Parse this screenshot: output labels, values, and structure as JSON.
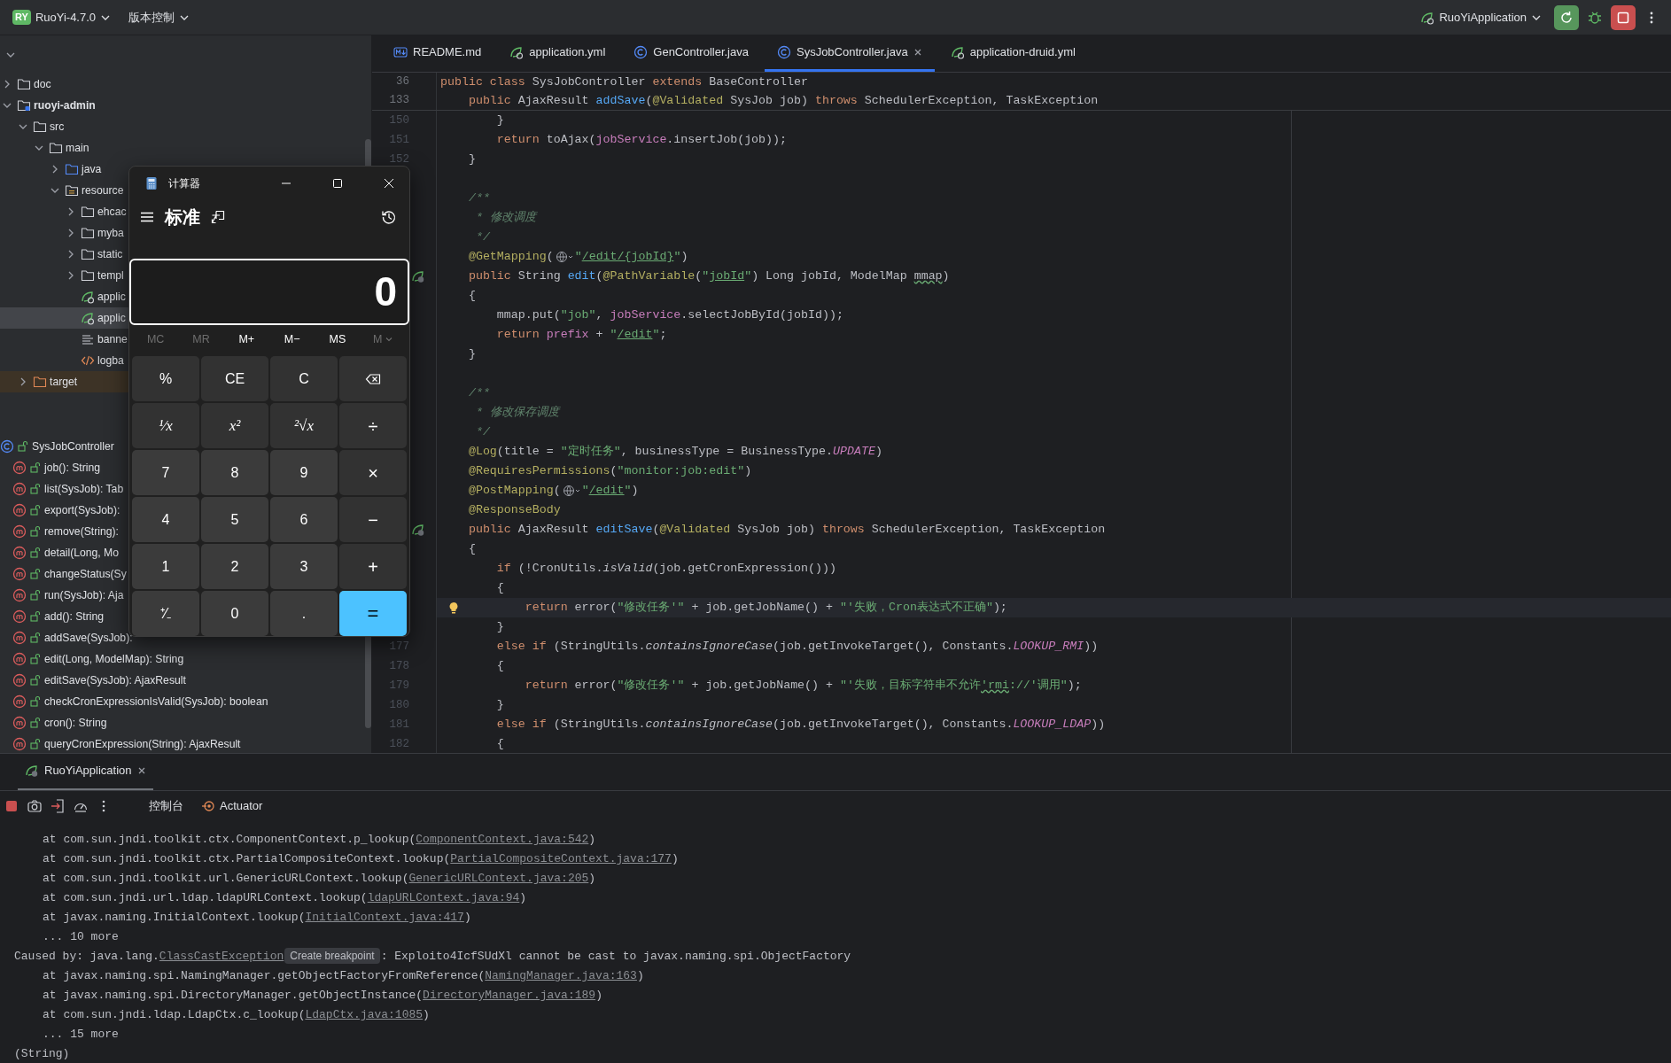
{
  "top_bar": {
    "project_badge": "RY",
    "project": "RuoYi-4.7.0",
    "vcs": "版本控制",
    "run_config": "RuoYiApplication"
  },
  "project_tree": [
    {
      "label": "doc",
      "kind": "folder",
      "expanded": false,
      "selected": false
    },
    {
      "label": "ruoyi-admin",
      "kind": "module",
      "expanded": true,
      "selected": false,
      "children": [
        {
          "label": "src",
          "kind": "folder",
          "expanded": true,
          "selected": false,
          "children": [
            {
              "label": "main",
              "kind": "folder",
              "expanded": true,
              "selected": false,
              "children": [
                {
                  "label": "java",
                  "kind": "source-folder",
                  "expanded": false,
                  "selected": false
                },
                {
                  "label": "resource",
                  "kind": "resource-folder",
                  "expanded": true,
                  "selected": false,
                  "children": [
                    {
                      "label": "ehcac",
                      "kind": "folder",
                      "expanded": false,
                      "selected": false
                    },
                    {
                      "label": "myba",
                      "kind": "folder",
                      "expanded": false,
                      "selected": false
                    },
                    {
                      "label": "static",
                      "kind": "folder",
                      "expanded": false,
                      "selected": false
                    },
                    {
                      "label": "templ",
                      "kind": "folder",
                      "expanded": false,
                      "selected": false
                    },
                    {
                      "label": "applic",
                      "kind": "spring-yml",
                      "selected": false
                    },
                    {
                      "label": "applic",
                      "kind": "spring-yml",
                      "selected": true
                    },
                    {
                      "label": "banne",
                      "kind": "text-file",
                      "selected": false
                    },
                    {
                      "label": "logba",
                      "kind": "xml-file",
                      "selected": false
                    }
                  ]
                }
              ]
            }
          ]
        },
        {
          "label": "target",
          "kind": "excluded-folder",
          "expanded": false,
          "selected": false
        }
      ]
    }
  ],
  "structure": {
    "label": "SysJobController",
    "members": [
      {
        "label": "job(): String",
        "selected": false
      },
      {
        "label": "list(SysJob): Tab",
        "selected": false
      },
      {
        "label": "export(SysJob):",
        "selected": false
      },
      {
        "label": "remove(String):",
        "selected": false
      },
      {
        "label": "detail(Long, Mo",
        "selected": false
      },
      {
        "label": "changeStatus(Sy",
        "selected": false
      },
      {
        "label": "run(SysJob): Aja",
        "selected": false
      },
      {
        "label": "add(): String",
        "selected": false
      },
      {
        "label": "addSave(SysJob):",
        "selected": false
      },
      {
        "label": "edit(Long, ModelMap): String",
        "selected": false
      },
      {
        "label": "editSave(SysJob): AjaxResult",
        "selected": false
      },
      {
        "label": "checkCronExpressionIsValid(SysJob): boolean",
        "selected": false
      },
      {
        "label": "cron(): String",
        "selected": false
      },
      {
        "label": "queryCronExpression(String): AjaxResult",
        "selected": false
      }
    ]
  },
  "editor": {
    "tabs": [
      {
        "label": "README.md",
        "kind": "markdown",
        "selected": false
      },
      {
        "label": "application.yml",
        "kind": "spring-yml",
        "selected": false
      },
      {
        "label": "GenController.java",
        "kind": "java-class",
        "selected": false
      },
      {
        "label": "SysJobController.java",
        "kind": "java-class",
        "selected": true
      },
      {
        "label": "application-druid.yml",
        "kind": "spring-yml",
        "selected": false
      }
    ],
    "sticky_lines": [
      {
        "number": "36",
        "tokens": [
          {
            "text": "public class",
            "kind": "keyword"
          },
          {
            "text": " SysJobController ",
            "kind": "plain"
          },
          {
            "text": "extends",
            "kind": "keyword"
          },
          {
            "text": " BaseController",
            "kind": "plain"
          }
        ]
      },
      {
        "number": "133",
        "tokens": [
          {
            "text": "    public",
            "kind": "keyword"
          },
          {
            "text": " AjaxResult ",
            "kind": "plain"
          },
          {
            "text": "addSave",
            "kind": "declaration"
          },
          {
            "text": "(",
            "kind": "plain"
          },
          {
            "text": "@Validated",
            "kind": "annotation"
          },
          {
            "text": " SysJob job) ",
            "kind": "plain"
          },
          {
            "text": "throws",
            "kind": "keyword"
          },
          {
            "text": " SchedulerException, TaskException",
            "kind": "plain"
          }
        ]
      }
    ],
    "lines": [
      {
        "kind": "code",
        "number": "150",
        "current": false,
        "run_marker": false,
        "bulb": false,
        "tokens": [
          {
            "text": "        }",
            "kind": "plain"
          }
        ]
      },
      {
        "kind": "code",
        "number": "151",
        "current": false,
        "run_marker": false,
        "bulb": false,
        "tokens": [
          {
            "text": "        return",
            "kind": "keyword"
          },
          {
            "text": " toAjax(",
            "kind": "plain"
          },
          {
            "text": "jobService",
            "kind": "field"
          },
          {
            "text": ".insertJob(job));",
            "kind": "plain"
          }
        ]
      },
      {
        "kind": "code",
        "number": "152",
        "current": false,
        "run_marker": false,
        "bulb": false,
        "tokens": [
          {
            "text": "    }",
            "kind": "plain"
          }
        ]
      },
      {
        "kind": "blank",
        "current": false,
        "run_marker": false,
        "bulb": false
      },
      {
        "kind": "code",
        "current": false,
        "run_marker": false,
        "bulb": false,
        "tokens": [
          {
            "text": "    /**",
            "kind": "doc"
          }
        ]
      },
      {
        "kind": "code",
        "current": false,
        "run_marker": false,
        "bulb": false,
        "tokens": [
          {
            "text": "     * 修改调度",
            "kind": "doc"
          }
        ]
      },
      {
        "kind": "code",
        "current": false,
        "run_marker": false,
        "bulb": false,
        "tokens": [
          {
            "text": "     */",
            "kind": "doc"
          }
        ]
      },
      {
        "kind": "code",
        "current": false,
        "run_marker": false,
        "bulb": false,
        "tokens": [
          {
            "text": "    @GetMapping",
            "kind": "annotation"
          },
          {
            "text": "(",
            "kind": "plain"
          },
          {
            "kind": "globe"
          },
          {
            "text": "\"",
            "kind": "string"
          },
          {
            "text": "/edit/{jobId}",
            "kind": "url"
          },
          {
            "text": "\"",
            "kind": "string"
          },
          {
            "text": ")",
            "kind": "plain"
          }
        ]
      },
      {
        "kind": "code",
        "current": false,
        "run_marker": true,
        "bulb": false,
        "tokens": [
          {
            "text": "    public",
            "kind": "keyword"
          },
          {
            "text": " String ",
            "kind": "plain"
          },
          {
            "text": "edit",
            "kind": "declaration"
          },
          {
            "text": "(",
            "kind": "plain"
          },
          {
            "text": "@PathVariable",
            "kind": "annotation"
          },
          {
            "text": "(",
            "kind": "plain"
          },
          {
            "text": "\"",
            "kind": "string"
          },
          {
            "text": "jobId",
            "kind": "url"
          },
          {
            "text": "\"",
            "kind": "string"
          },
          {
            "text": ") Long jobId, ModelMap ",
            "kind": "plain"
          },
          {
            "text": "mmap",
            "kind": "typo"
          },
          {
            "text": ")",
            "kind": "plain"
          }
        ]
      },
      {
        "kind": "code",
        "current": false,
        "run_marker": false,
        "bulb": false,
        "tokens": [
          {
            "text": "    {",
            "kind": "plain"
          }
        ]
      },
      {
        "kind": "code",
        "current": false,
        "run_marker": false,
        "bulb": false,
        "tokens": [
          {
            "text": "        mmap.put(",
            "kind": "plain"
          },
          {
            "text": "\"job\"",
            "kind": "string"
          },
          {
            "text": ", ",
            "kind": "plain"
          },
          {
            "text": "jobService",
            "kind": "field"
          },
          {
            "text": ".selectJobById(jobId));",
            "kind": "plain"
          }
        ]
      },
      {
        "kind": "code",
        "current": false,
        "run_marker": false,
        "bulb": false,
        "tokens": [
          {
            "text": "        return",
            "kind": "keyword"
          },
          {
            "text": " prefix",
            "kind": "field"
          },
          {
            "text": " + ",
            "kind": "plain"
          },
          {
            "text": "\"",
            "kind": "string"
          },
          {
            "text": "/edit",
            "kind": "url"
          },
          {
            "text": "\"",
            "kind": "string"
          },
          {
            "text": ";",
            "kind": "plain"
          }
        ]
      },
      {
        "kind": "code",
        "current": false,
        "run_marker": false,
        "bulb": false,
        "tokens": [
          {
            "text": "    }",
            "kind": "plain"
          }
        ]
      },
      {
        "kind": "blank",
        "current": false,
        "run_marker": false,
        "bulb": false
      },
      {
        "kind": "code",
        "current": false,
        "run_marker": false,
        "bulb": false,
        "tokens": [
          {
            "text": "    /**",
            "kind": "doc"
          }
        ]
      },
      {
        "kind": "code",
        "current": false,
        "run_marker": false,
        "bulb": false,
        "tokens": [
          {
            "text": "     * 修改保存调度",
            "kind": "doc"
          }
        ]
      },
      {
        "kind": "code",
        "current": false,
        "run_marker": false,
        "bulb": false,
        "tokens": [
          {
            "text": "     */",
            "kind": "doc"
          }
        ]
      },
      {
        "kind": "code",
        "current": false,
        "run_marker": false,
        "bulb": false,
        "tokens": [
          {
            "text": "    @Log",
            "kind": "annotation"
          },
          {
            "text": "(title = ",
            "kind": "plain"
          },
          {
            "text": "\"定时任务\"",
            "kind": "string"
          },
          {
            "text": ", businessType = BusinessType.",
            "kind": "plain"
          },
          {
            "text": "UPDATE",
            "kind": "constant"
          },
          {
            "text": ")",
            "kind": "plain"
          }
        ]
      },
      {
        "kind": "code",
        "current": false,
        "run_marker": false,
        "bulb": false,
        "tokens": [
          {
            "text": "    @RequiresPermissions",
            "kind": "annotation"
          },
          {
            "text": "(",
            "kind": "plain"
          },
          {
            "text": "\"monitor:job:edit\"",
            "kind": "string"
          },
          {
            "text": ")",
            "kind": "plain"
          }
        ]
      },
      {
        "kind": "code",
        "current": false,
        "run_marker": false,
        "bulb": false,
        "tokens": [
          {
            "text": "    @PostMapping",
            "kind": "annotation"
          },
          {
            "text": "(",
            "kind": "plain"
          },
          {
            "kind": "globe"
          },
          {
            "text": "\"",
            "kind": "string"
          },
          {
            "text": "/edit",
            "kind": "url"
          },
          {
            "text": "\"",
            "kind": "string"
          },
          {
            "text": ")",
            "kind": "plain"
          }
        ]
      },
      {
        "kind": "code",
        "current": false,
        "run_marker": false,
        "bulb": false,
        "tokens": [
          {
            "text": "    @ResponseBody",
            "kind": "annotation"
          }
        ]
      },
      {
        "kind": "code",
        "current": false,
        "run_marker": true,
        "bulb": false,
        "tokens": [
          {
            "text": "    public",
            "kind": "keyword"
          },
          {
            "text": " AjaxResult ",
            "kind": "plain"
          },
          {
            "text": "editSave",
            "kind": "declaration"
          },
          {
            "text": "(",
            "kind": "plain"
          },
          {
            "text": "@Validated",
            "kind": "annotation"
          },
          {
            "text": " SysJob job) ",
            "kind": "plain"
          },
          {
            "text": "throws",
            "kind": "keyword"
          },
          {
            "text": " SchedulerException, TaskException",
            "kind": "plain"
          }
        ]
      },
      {
        "kind": "code",
        "current": false,
        "run_marker": false,
        "bulb": false,
        "tokens": [
          {
            "text": "    {",
            "kind": "plain"
          }
        ]
      },
      {
        "kind": "code",
        "current": false,
        "run_marker": false,
        "bulb": false,
        "tokens": [
          {
            "text": "        if",
            "kind": "keyword"
          },
          {
            "text": " (!CronUtils.",
            "kind": "plain"
          },
          {
            "text": "isValid",
            "kind": "static"
          },
          {
            "text": "(job.getCronExpression()))",
            "kind": "plain"
          }
        ]
      },
      {
        "kind": "code",
        "current": false,
        "run_marker": false,
        "bulb": false,
        "tokens": [
          {
            "text": "        {",
            "kind": "plain"
          }
        ]
      },
      {
        "kind": "code",
        "current": true,
        "run_marker": false,
        "bulb": true,
        "tokens": [
          {
            "text": "            return",
            "kind": "keyword"
          },
          {
            "text": " error(",
            "kind": "plain"
          },
          {
            "text": "\"修改任务'\"",
            "kind": "string"
          },
          {
            "text": " + job.getJobName() + ",
            "kind": "plain"
          },
          {
            "text": "\"'失败，Cron表达式不正确\"",
            "kind": "string"
          },
          {
            "text": ");",
            "kind": "plain"
          }
        ]
      },
      {
        "kind": "code",
        "current": false,
        "run_marker": false,
        "bulb": false,
        "tokens": [
          {
            "text": "        }",
            "kind": "plain"
          }
        ]
      },
      {
        "kind": "code",
        "number": "177",
        "current": false,
        "run_marker": false,
        "bulb": false,
        "tokens": [
          {
            "text": "        else if",
            "kind": "keyword"
          },
          {
            "text": " (StringUtils.",
            "kind": "plain"
          },
          {
            "text": "containsIgnoreCase",
            "kind": "static"
          },
          {
            "text": "(job.getInvokeTarget(), Constants.",
            "kind": "plain"
          },
          {
            "text": "LOOKUP_RMI",
            "kind": "constant"
          },
          {
            "text": "))",
            "kind": "plain"
          }
        ]
      },
      {
        "kind": "code",
        "number": "178",
        "current": false,
        "run_marker": false,
        "bulb": false,
        "tokens": [
          {
            "text": "        {",
            "kind": "plain"
          }
        ]
      },
      {
        "kind": "code",
        "number": "179",
        "current": false,
        "run_marker": false,
        "bulb": false,
        "tokens": [
          {
            "text": "            return",
            "kind": "keyword"
          },
          {
            "text": " error(",
            "kind": "plain"
          },
          {
            "text": "\"修改任务'\"",
            "kind": "string"
          },
          {
            "text": " + job.getJobName() + ",
            "kind": "plain"
          },
          {
            "text": "\"'失败，目标字符串不允许",
            "kind": "string"
          },
          {
            "text": "'rmi",
            "kind": "string-typo"
          },
          {
            "text": "://'调用\"",
            "kind": "string"
          },
          {
            "text": ");",
            "kind": "plain"
          }
        ]
      },
      {
        "kind": "code",
        "number": "180",
        "current": false,
        "run_marker": false,
        "bulb": false,
        "tokens": [
          {
            "text": "        }",
            "kind": "plain"
          }
        ]
      },
      {
        "kind": "code",
        "number": "181",
        "current": false,
        "run_marker": false,
        "bulb": false,
        "tokens": [
          {
            "text": "        else if",
            "kind": "keyword"
          },
          {
            "text": " (StringUtils.",
            "kind": "plain"
          },
          {
            "text": "containsIgnoreCase",
            "kind": "static"
          },
          {
            "text": "(job.getInvokeTarget(), Constants.",
            "kind": "plain"
          },
          {
            "text": "LOOKUP_LDAP",
            "kind": "constant"
          },
          {
            "text": "))",
            "kind": "plain"
          }
        ]
      },
      {
        "kind": "code",
        "number": "182",
        "current": false,
        "run_marker": false,
        "bulb": false,
        "tokens": [
          {
            "text": "        {",
            "kind": "plain"
          }
        ]
      }
    ]
  },
  "calculator": {
    "title": "计算器",
    "mode": "标准",
    "display": "0",
    "memory": [
      {
        "label": "MC",
        "kind": "plain",
        "disabled": true
      },
      {
        "label": "MR",
        "kind": "plain",
        "disabled": true
      },
      {
        "label": "M+",
        "kind": "plain",
        "disabled": false
      },
      {
        "label": "M−",
        "kind": "plain",
        "disabled": false
      },
      {
        "label": "MS",
        "kind": "plain",
        "disabled": false
      },
      {
        "label": "M",
        "kind": "dropdown",
        "disabled": true
      }
    ],
    "keys": [
      {
        "label": "%",
        "kind": "function"
      },
      {
        "label": "CE",
        "kind": "function"
      },
      {
        "label": "C",
        "kind": "function"
      },
      {
        "kind": "backspace"
      },
      {
        "label": "¹⁄x",
        "kind": "math"
      },
      {
        "label": "x²",
        "kind": "math"
      },
      {
        "label": "²√x",
        "kind": "math"
      },
      {
        "label": "÷",
        "kind": "operator"
      },
      {
        "label": "7",
        "kind": "digit"
      },
      {
        "label": "8",
        "kind": "digit"
      },
      {
        "label": "9",
        "kind": "digit"
      },
      {
        "label": "×",
        "kind": "operator"
      },
      {
        "label": "4",
        "kind": "digit"
      },
      {
        "label": "5",
        "kind": "digit"
      },
      {
        "label": "6",
        "kind": "digit"
      },
      {
        "label": "−",
        "kind": "operator"
      },
      {
        "label": "1",
        "kind": "digit"
      },
      {
        "label": "2",
        "kind": "digit"
      },
      {
        "label": "3",
        "kind": "digit"
      },
      {
        "label": "+",
        "kind": "operator"
      },
      {
        "label": "⁺⁄₋",
        "kind": "digit"
      },
      {
        "label": "0",
        "kind": "digit"
      },
      {
        "label": ".",
        "kind": "digit"
      },
      {
        "label": "=",
        "kind": "equals"
      }
    ]
  },
  "run_panel": {
    "tab": "RuoYiApplication",
    "toolbar": [
      {
        "label": "控制台",
        "kind": "plain"
      },
      {
        "label": "Actuator",
        "kind": "actuator"
      }
    ],
    "console": [
      {
        "kind": "frame",
        "parts": [
          {
            "text": "at com.sun.jndi.toolkit.ctx.ComponentContext.p_lookup(",
            "kind": "plain"
          },
          {
            "text": "ComponentContext.java:542",
            "kind": "link"
          },
          {
            "text": ")",
            "kind": "plain"
          }
        ]
      },
      {
        "kind": "frame",
        "parts": [
          {
            "text": "at com.sun.jndi.toolkit.ctx.PartialCompositeContext.lookup(",
            "kind": "plain"
          },
          {
            "text": "PartialCompositeContext.java:177",
            "kind": "link"
          },
          {
            "text": ")",
            "kind": "plain"
          }
        ]
      },
      {
        "kind": "frame",
        "parts": [
          {
            "text": "at com.sun.jndi.toolkit.url.GenericURLContext.lookup(",
            "kind": "plain"
          },
          {
            "text": "GenericURLContext.java:205",
            "kind": "link"
          },
          {
            "text": ")",
            "kind": "plain"
          }
        ]
      },
      {
        "kind": "frame",
        "parts": [
          {
            "text": "at com.sun.jndi.url.ldap.ldapURLContext.lookup(",
            "kind": "plain"
          },
          {
            "text": "ldapURLContext.java:94",
            "kind": "link"
          },
          {
            "text": ")",
            "kind": "plain"
          }
        ]
      },
      {
        "kind": "frame",
        "parts": [
          {
            "text": "at javax.naming.InitialContext.lookup(",
            "kind": "plain"
          },
          {
            "text": "InitialContext.java:417",
            "kind": "link"
          },
          {
            "text": ")",
            "kind": "plain"
          }
        ]
      },
      {
        "kind": "frame",
        "parts": [
          {
            "text": "... 10 more",
            "kind": "plain"
          }
        ]
      },
      {
        "kind": "message",
        "parts": [
          {
            "text": "Caused by: java.lang.",
            "kind": "plain"
          },
          {
            "text": "ClassCastException",
            "kind": "link"
          },
          {
            "text": "Create breakpoint",
            "kind": "hint"
          },
          {
            "text": ": Exploito4IcfSUdXl cannot be cast to javax.naming.spi.ObjectFactory",
            "kind": "plain"
          }
        ]
      },
      {
        "kind": "frame",
        "parts": [
          {
            "text": "at javax.naming.spi.NamingManager.getObjectFactoryFromReference(",
            "kind": "plain"
          },
          {
            "text": "NamingManager.java:163",
            "kind": "link"
          },
          {
            "text": ")",
            "kind": "plain"
          }
        ]
      },
      {
        "kind": "frame",
        "parts": [
          {
            "text": "at javax.naming.spi.DirectoryManager.getObjectInstance(",
            "kind": "plain"
          },
          {
            "text": "DirectoryManager.java:189",
            "kind": "link"
          },
          {
            "text": ")",
            "kind": "plain"
          }
        ]
      },
      {
        "kind": "frame",
        "parts": [
          {
            "text": "at com.sun.jndi.ldap.LdapCtx.c_lookup(",
            "kind": "plain"
          },
          {
            "text": "LdapCtx.java:1085",
            "kind": "link"
          },
          {
            "text": ")",
            "kind": "plain"
          }
        ]
      },
      {
        "kind": "frame",
        "parts": [
          {
            "text": "... 15 more",
            "kind": "plain"
          }
        ]
      },
      {
        "kind": "message",
        "parts": [
          {
            "text": "(String)",
            "kind": "plain"
          }
        ]
      }
    ]
  }
}
